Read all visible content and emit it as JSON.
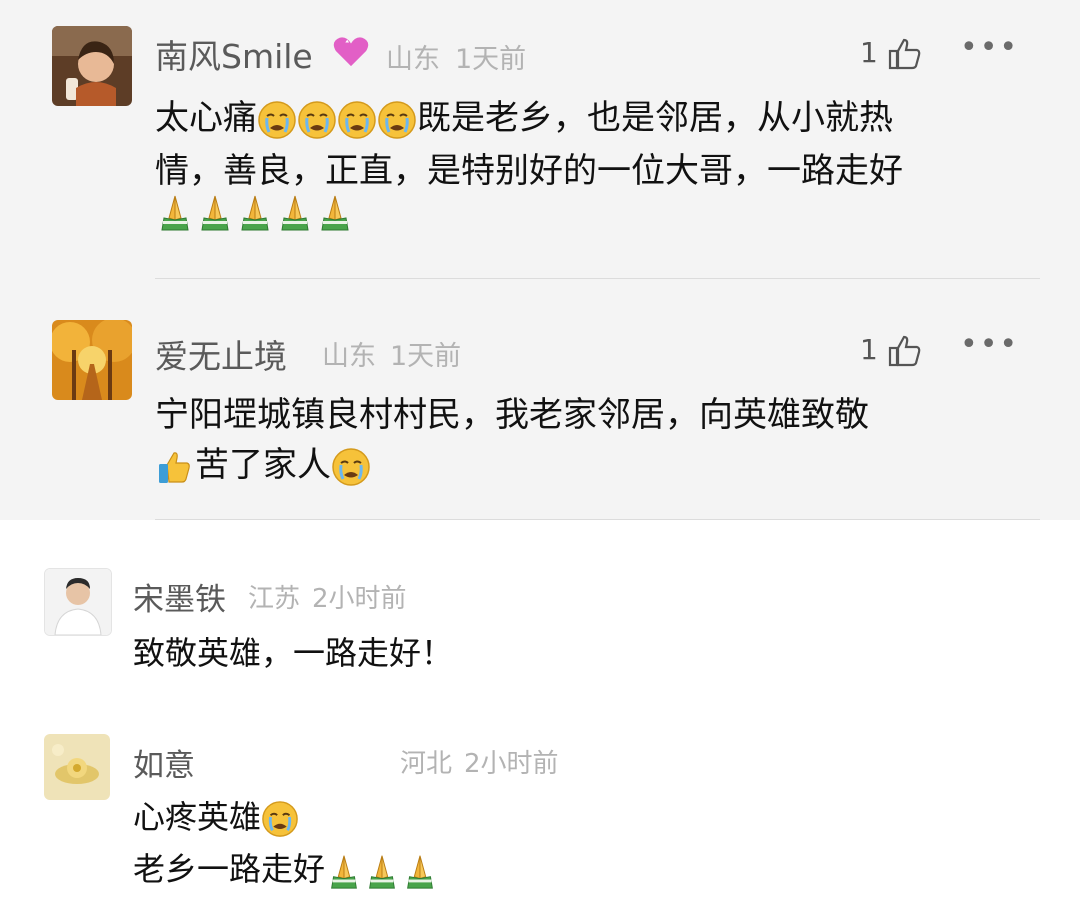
{
  "comments": [
    {
      "username": "南风Smile",
      "location": "山东",
      "time": "1天前",
      "likes": "1",
      "avatar_icon": "child-portrait-icon",
      "lines": [
        {
          "t1": "太心痛",
          "t2": "既是老乡，也是邻居，从小就热"
        },
        {
          "t1": "情，善良，正直，是特别好的一位大哥，一路走好"
        }
      ]
    },
    {
      "username": "爱无止境",
      "location": "山东",
      "time": "1天前",
      "likes": "1",
      "avatar_icon": "autumn-trees-icon",
      "lines": [
        {
          "t1": "宁阳堽城镇良村村民，我老家邻居，向英雄致敬"
        },
        {
          "t2": "苦了家人"
        }
      ]
    },
    {
      "username": "宋墨铁",
      "location": "江苏",
      "time": "2小时前",
      "avatar_icon": "man-portrait-icon",
      "lines": [
        {
          "t1": "致敬英雄，一路走好！"
        }
      ]
    },
    {
      "username": "如意",
      "location": "河北",
      "time": "2小时前",
      "avatar_icon": "golden-flower-icon",
      "lines": [
        {
          "t1": "心疼英雄"
        },
        {
          "t1": "老乡一路走好"
        }
      ]
    }
  ],
  "emoji": {
    "sad": "crying-face-icon",
    "pray": "praying-hands-icon",
    "thumbs": "thumbs-up-icon",
    "like": "thumb-up-outline-icon",
    "more": "more-dots-icon"
  },
  "colors": {
    "emoji_face": "#f6c23a",
    "pray_hands": "#f2b53a",
    "pray_sleeve": "#49a44b",
    "meta": "#b3b3b3"
  }
}
